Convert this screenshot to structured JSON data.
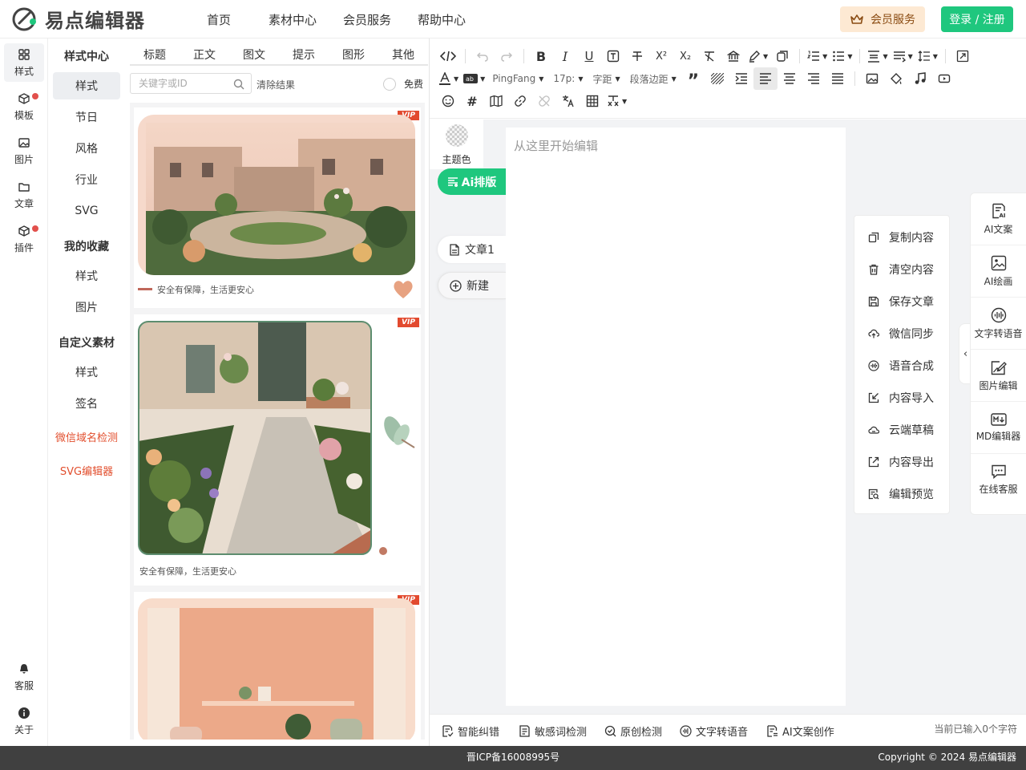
{
  "brand": {
    "name": "易点编辑器"
  },
  "nav": [
    "首页",
    "素材中心",
    "会员服务",
    "帮助中心"
  ],
  "header": {
    "vip_label": "会员服务",
    "login_label": "登录 / 注册"
  },
  "rail": [
    {
      "label": "样式",
      "icon": "grid-icon"
    },
    {
      "label": "模板",
      "icon": "cube-icon",
      "badge": true
    },
    {
      "label": "图片",
      "icon": "image-icon"
    },
    {
      "label": "文章",
      "icon": "folder-icon"
    },
    {
      "label": "插件",
      "icon": "box-icon",
      "badge": true
    }
  ],
  "rail_bottom": [
    {
      "label": "客服",
      "icon": "service-icon"
    },
    {
      "label": "关于",
      "icon": "info-icon"
    }
  ],
  "categories": {
    "style_center": "样式中心",
    "style_items": [
      "样式",
      "节日",
      "风格",
      "行业",
      "SVG"
    ],
    "favorites": "我的收藏",
    "favorite_items": [
      "样式",
      "图片"
    ],
    "custom": "自定义素材",
    "custom_items": [
      "样式",
      "签名"
    ],
    "links": [
      "微信域名检测",
      "SVG编辑器"
    ]
  },
  "materials": {
    "tabs": [
      "标题",
      "正文",
      "图文",
      "提示",
      "图形",
      "其他"
    ],
    "search_placeholder": "关键字或ID",
    "clear_label": "清除结果",
    "free_label": "免费",
    "vip_tag": "VIP",
    "card1_caption": "安全有保障，生活更安心",
    "card2_caption": "安全有保障，生活更安心"
  },
  "toolbar": {
    "font_family": "PingFang",
    "font_size": "17p:",
    "letter_spacing": "字距",
    "paragraph_margin": "段落边距"
  },
  "editor": {
    "theme_label": "主题色",
    "ai_label": "Ai排版",
    "doc_tab": "文章1",
    "new_tab": "新建",
    "placeholder": "从这里开始编辑"
  },
  "context_menu": [
    "复制内容",
    "清空内容",
    "保存文章",
    "微信同步",
    "语音合成",
    "内容导入",
    "云端草稿",
    "内容导出",
    "编辑预览"
  ],
  "side_panel": [
    "AI文案",
    "AI绘画",
    "文字转语音",
    "图片编辑",
    "MD编辑器",
    "在线客服"
  ],
  "bottom_bar": {
    "items": [
      "智能纠错",
      "敏感词检测",
      "原创检测",
      "文字转语音",
      "AI文案创作"
    ],
    "char_count": "当前已输入0个字符"
  },
  "footer": {
    "icp": "晋ICP备16008995号",
    "copyright": "Copyright © 2024 易点编辑器"
  },
  "colors": {
    "accent": "#1fc77e",
    "vip_bg": "#fde9d3",
    "badge": "#e2504c",
    "link_red": "#e24f2e"
  }
}
